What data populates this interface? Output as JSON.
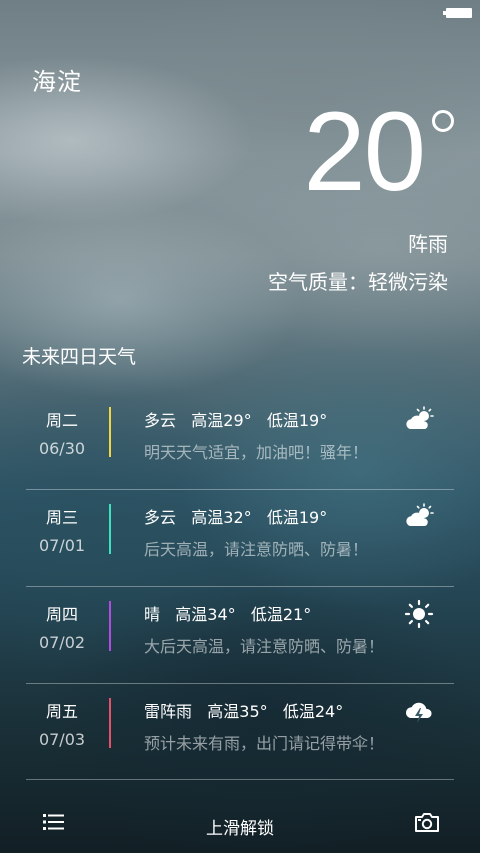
{
  "status_bar": {
    "battery_icon": "battery-full-icon"
  },
  "location": {
    "city": "海淀"
  },
  "current": {
    "temperature": "20",
    "condition": "阵雨",
    "air_quality": "空气质量：轻微污染"
  },
  "forecast": {
    "title": "未来四日天气",
    "days": [
      {
        "weekday": "周二",
        "date": "06/30",
        "summary": "多云   高温29°   低温19°",
        "tip": "明天天气适宜，加油吧！骚年！",
        "bar_color": "#f2d640",
        "icon": "partly-cloudy-icon"
      },
      {
        "weekday": "周三",
        "date": "07/01",
        "summary": "多云   高温32°   低温19°",
        "tip": "后天高温，请注意防晒、防暑！",
        "bar_color": "#3fe0c0",
        "icon": "partly-cloudy-icon"
      },
      {
        "weekday": "周四",
        "date": "07/02",
        "summary": "晴   高温34°   低温21°",
        "tip": "大后天高温，请注意防晒、防暑！",
        "bar_color": "#b04ce0",
        "icon": "sun-icon"
      },
      {
        "weekday": "周五",
        "date": "07/03",
        "summary": "雷阵雨   高温35°   低温24°",
        "tip": "预计未来有雨，出门请记得带伞！",
        "bar_color": "#e8506a",
        "icon": "thunderstorm-icon"
      }
    ]
  },
  "bottom_bar": {
    "unlock_label": "上滑解锁",
    "menu_icon": "list-menu-icon",
    "camera_icon": "camera-icon"
  }
}
